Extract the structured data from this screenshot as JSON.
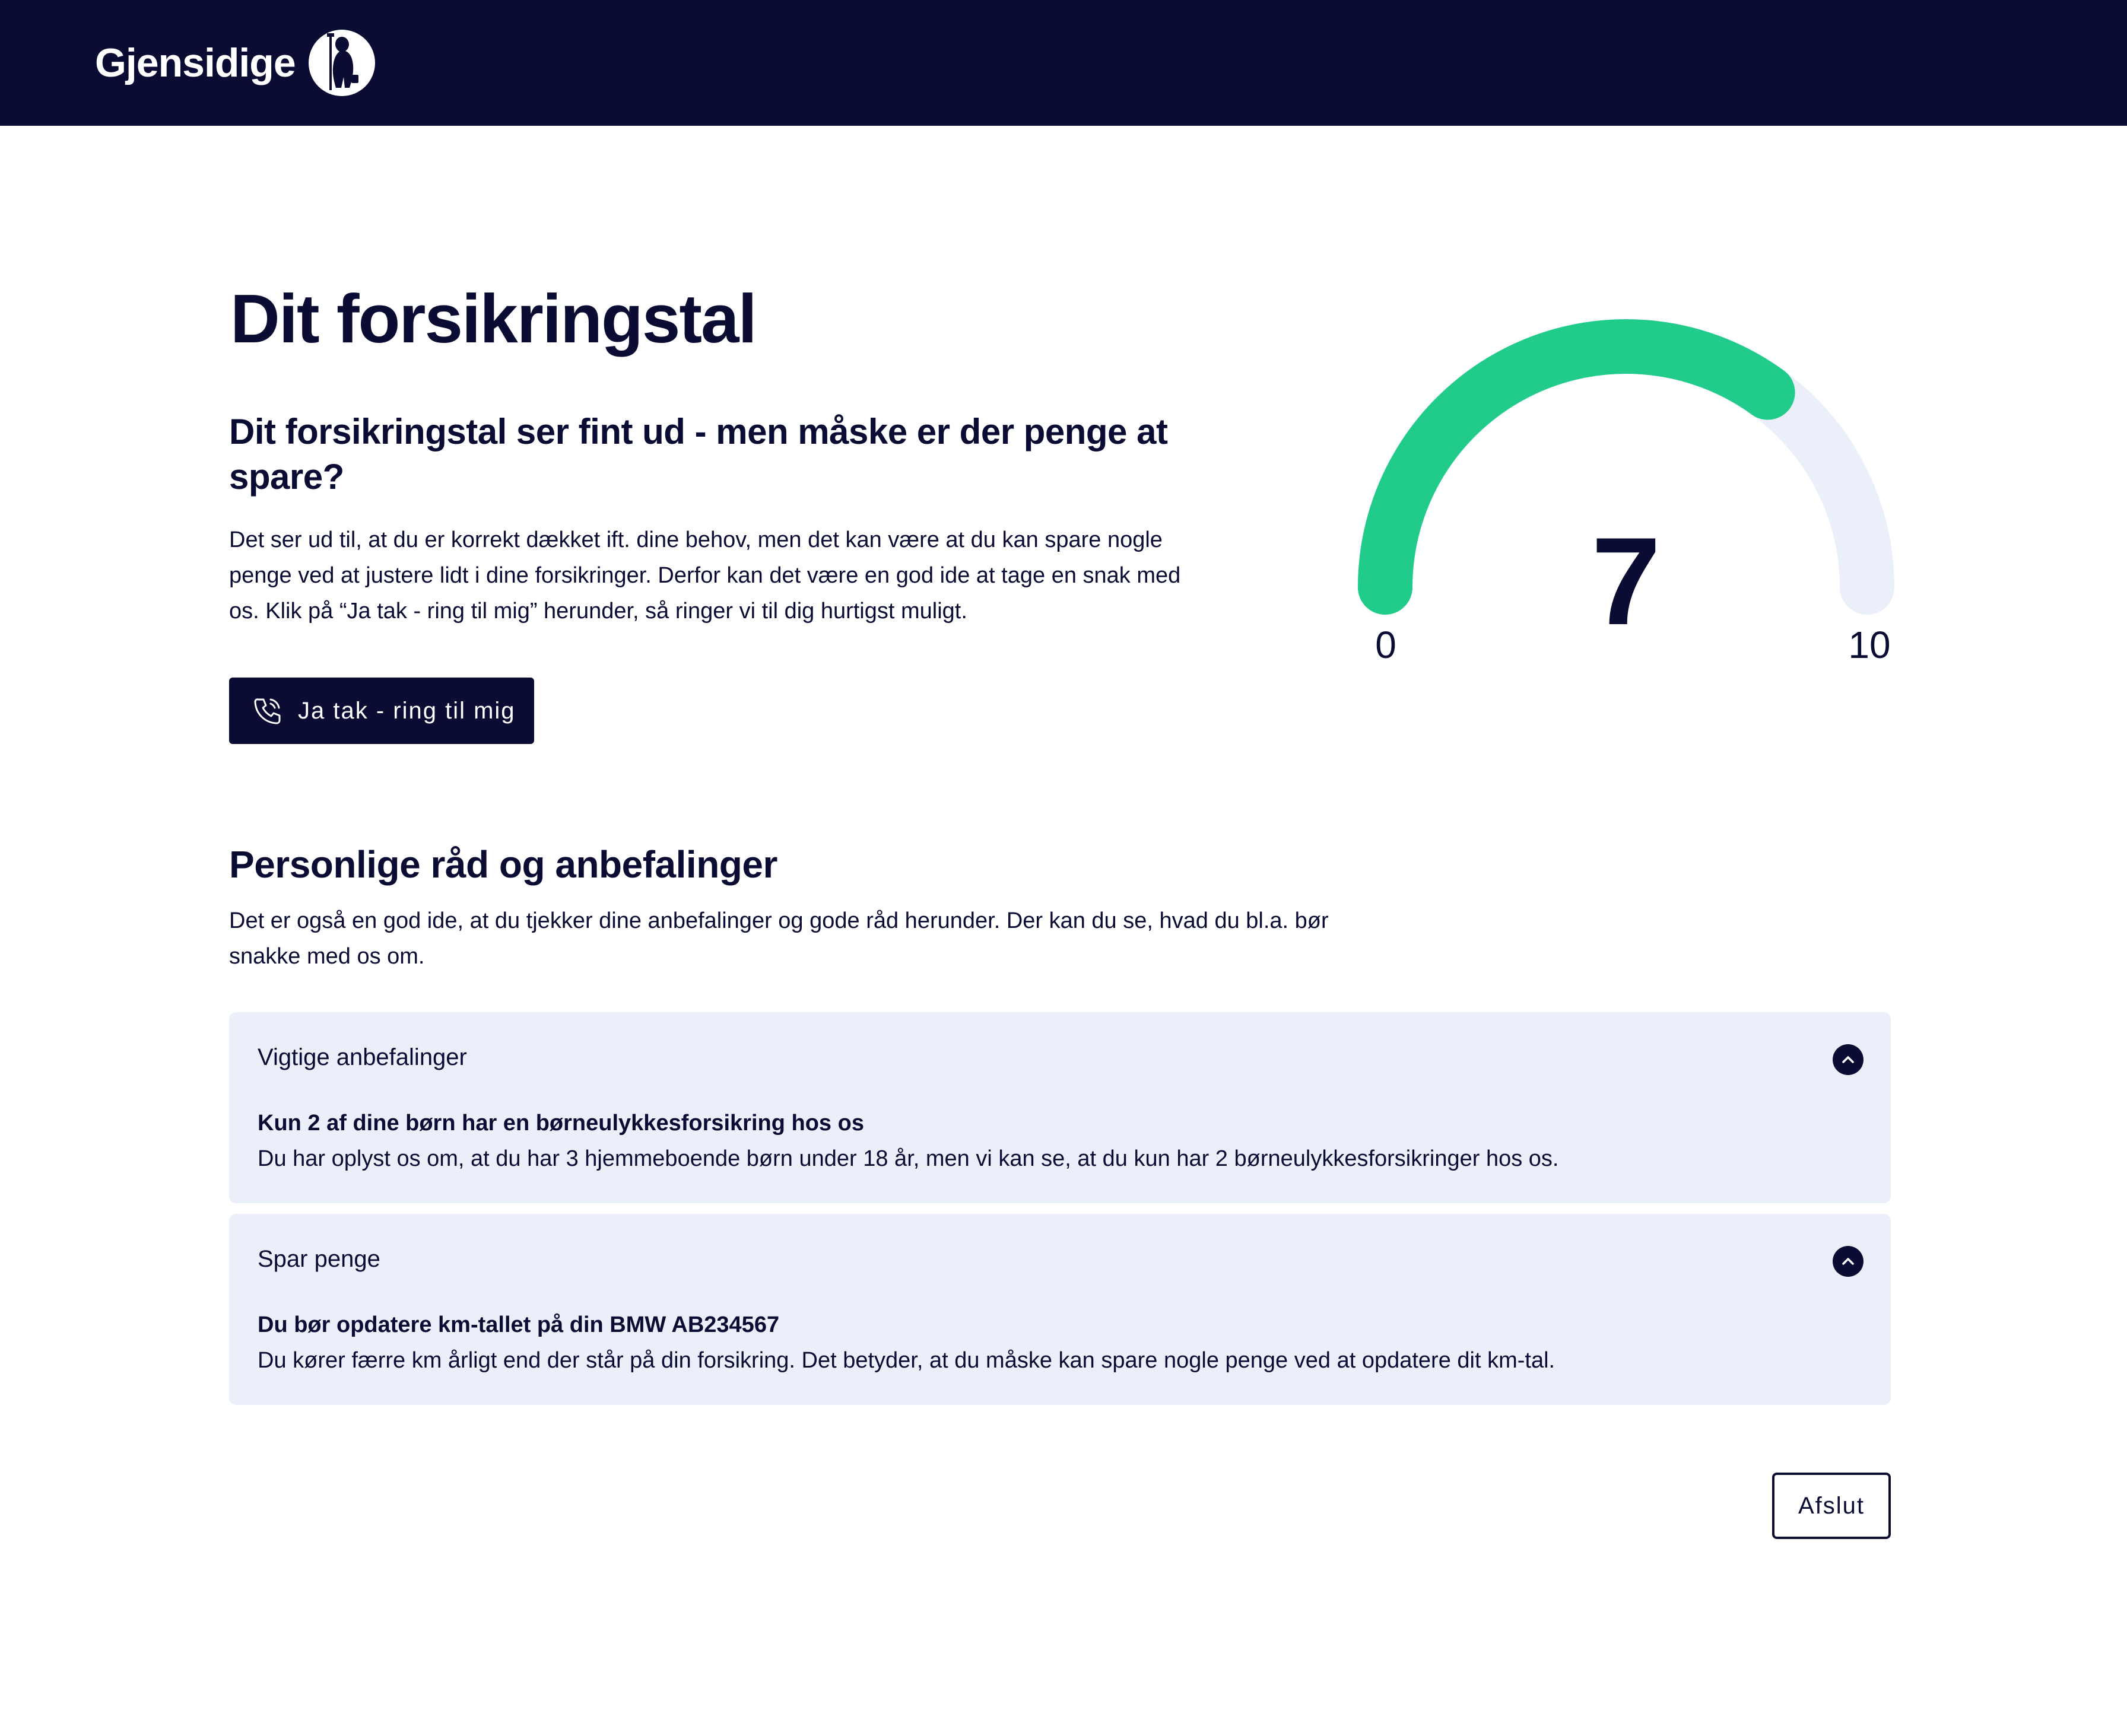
{
  "header": {
    "brand_name": "Gjensidige",
    "logo_icon": "knight-silhouette-icon",
    "background_color": "#0a0c33"
  },
  "main": {
    "title": "Dit forsikringstal",
    "subtitle": "Dit forsikringstal ser fint ud - men måske er der penge at spare?",
    "intro": "Det ser ud til, at du er korrekt dækket ift. dine behov, men det kan være at du kan spare nogle penge ved at justere lidt i dine forsikringer. Derfor kan det være en god ide at tage en snak med os. Klik på “Ja tak - ring til mig” herunder, så ringer vi til dig hurtigst muligt.",
    "call_button_label": "Ja tak - ring til mig",
    "call_button_icon": "phone-icon"
  },
  "gauge": {
    "value": "7",
    "min_label": "0",
    "max_label": "10",
    "min": 0,
    "max": 10,
    "score": 7,
    "fill_color": "#21cc8a",
    "track_color": "#ebeff9"
  },
  "recommendations": {
    "title": "Personlige råd og anbefalinger",
    "description": "Det er også en god ide, at du tjekker dine anbefalinger og gode råd herunder. Der kan du se, hvad du bl.a. bør snakke med os om.",
    "sections": [
      {
        "heading": "Vigtige anbefalinger",
        "item_title": "Kun 2 af dine børn har en børneulykkesforsikring hos os",
        "item_text": "Du har oplyst os om, at du har 3 hjemmeboende børn under 18 år, men vi kan se, at du kun har 2 børneulykkesforsikringer hos os.",
        "toggle_icon": "chevron-up-icon"
      },
      {
        "heading": "Spar penge",
        "item_title": "Du bør opdatere km-tallet på din BMW AB234567",
        "item_text": "Du kører færre km årligt end der står på din forsikring. Det betyder, at du måske kan spare nogle penge ved at opdatere dit km-tal.",
        "toggle_icon": "chevron-up-icon"
      }
    ]
  },
  "footer": {
    "close_button_label": "Afslut"
  }
}
